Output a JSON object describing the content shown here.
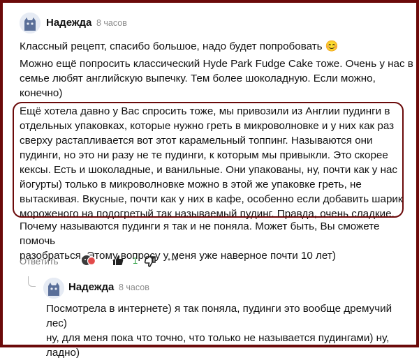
{
  "comment": {
    "author": "Надежда",
    "time": "8 часов",
    "paragraphs": [
      "Классный рецепт, спасибо большое, надо будет попробовать 😊",
      "Можно ещё попросить классический Hyde Park Fudge Cake тоже. Очень у нас в\nсемье любят английскую выпечку. Тем более шоколадную. Если можно,\nконечно)",
      "Ещё хотела давно у Вас спросить тоже, мы привозили из Англии пудинги в\nотдельных упаковках, которые нужно греть в микроволновке и у них как раз\nсверху растапливается вот этот карамельный топпинг. Называются они\nпудинги, но это ни разу не те пудинги, к которым мы привыкли. Это скорее\nкексы. Есть и шоколадные, и ванильные. Они упакованы, ну, почти как у нас\nйогурты) только в микроволновке можно в этой же упаковке греть, не\nвытаскивая. Вкусные, почти как у них в кафе, особенно если добавить шарик\nмороженого на подогретый так называемый пудинг. Правда, очень сладкие.",
      "Почему называются пудинги я так и не поняла. Может быть, Вы сможете помочь\nразобраться. Этому вопросу у меня уже наверное почти 10 лет)"
    ],
    "actions": {
      "reply_label": "Ответить",
      "like_count": "1",
      "more_label": "•••"
    }
  },
  "reply": {
    "author": "Надежда",
    "time": "8 часов",
    "text": "Посмотрела в интернете) я так поняла, пудинги это вообще дремучий лес)\nну, для меня пока что точно, что только не называется пудингами) ну,\nладно)"
  },
  "colors": {
    "frame": "#6b0a0a",
    "like_count": "#2ea043",
    "muted": "#8b8b8b"
  }
}
